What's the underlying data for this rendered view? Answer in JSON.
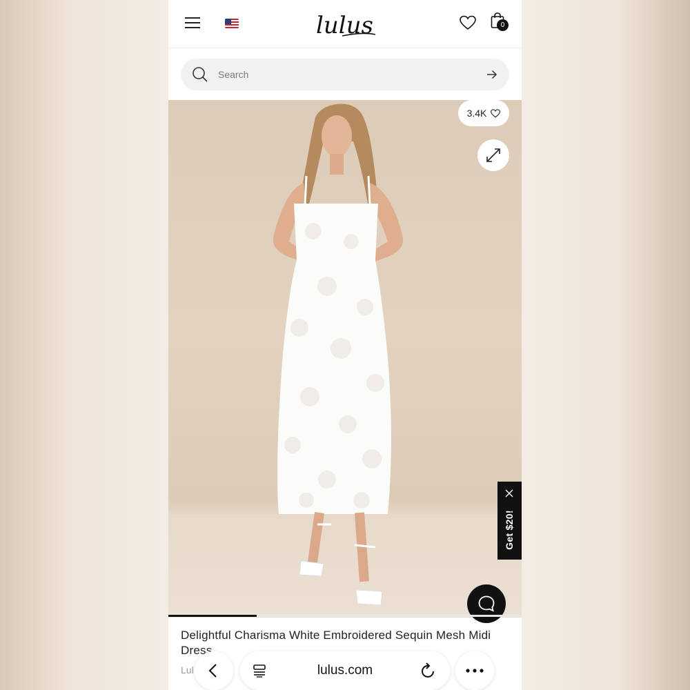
{
  "header": {
    "logo_text": "lulus",
    "bag_count": "0",
    "icons": [
      "menu-icon",
      "us-flag-icon",
      "heart-icon",
      "shopping-bag-icon"
    ]
  },
  "search": {
    "placeholder": "Search",
    "icons": [
      "search-icon",
      "arrow-right-icon"
    ]
  },
  "product_image": {
    "likes": "3.4K",
    "icons": [
      "heart-icon",
      "expand-icon",
      "close-icon",
      "chat-icon"
    ],
    "gallery_progress": 0.25
  },
  "promo": {
    "label": "Get $20!"
  },
  "product": {
    "title": "Delightful Charisma White Embroidered Sequin Mesh Midi Dress",
    "brand_partial": "Lul"
  },
  "browser": {
    "url": "lulus.com",
    "icons": [
      "back-icon",
      "tabs-icon",
      "reload-icon",
      "more-icon"
    ]
  },
  "colors": {
    "accent": "#111111",
    "search_bg": "#f1f1f1",
    "hero_bg": "#dccbb7"
  }
}
